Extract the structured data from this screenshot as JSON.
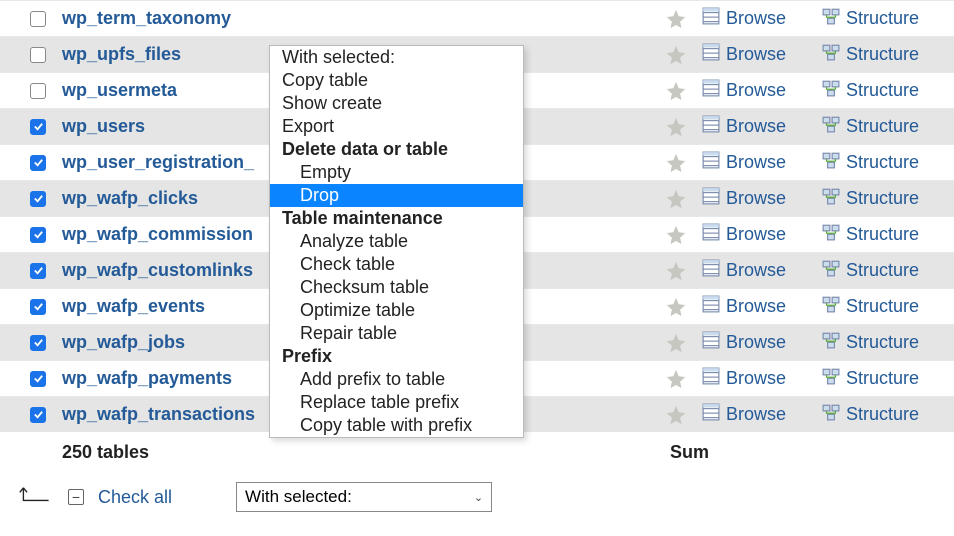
{
  "rows": [
    {
      "name": "wp_term_taxonomy",
      "checked": false,
      "alt": false
    },
    {
      "name": "wp_upfs_files",
      "checked": false,
      "alt": true
    },
    {
      "name": "wp_usermeta",
      "checked": false,
      "alt": false
    },
    {
      "name": "wp_users",
      "checked": true,
      "alt": true
    },
    {
      "name": "wp_user_registration_",
      "checked": true,
      "alt": false
    },
    {
      "name": "wp_wafp_clicks",
      "checked": true,
      "alt": true
    },
    {
      "name": "wp_wafp_commission",
      "checked": true,
      "alt": false
    },
    {
      "name": "wp_wafp_customlinks",
      "checked": true,
      "alt": true
    },
    {
      "name": "wp_wafp_events",
      "checked": true,
      "alt": false
    },
    {
      "name": "wp_wafp_jobs",
      "checked": true,
      "alt": true
    },
    {
      "name": "wp_wafp_payments",
      "checked": true,
      "alt": false
    },
    {
      "name": "wp_wafp_transactions",
      "checked": true,
      "alt": true
    }
  ],
  "actions": {
    "browse": "Browse",
    "structure": "Structure"
  },
  "summary": {
    "count": "250 tables",
    "sum": "Sum"
  },
  "bottom": {
    "check_all": "Check all",
    "dropdown": "With selected:"
  },
  "ctx": {
    "header1": "With selected:",
    "copy": "Copy table",
    "show_create": "Show create",
    "export": "Export",
    "header2": "Delete data or table",
    "empty": "Empty",
    "drop": "Drop",
    "header3": "Table maintenance",
    "analyze": "Analyze table",
    "check": "Check table",
    "checksum": "Checksum table",
    "optimize": "Optimize table",
    "repair": "Repair table",
    "header4": "Prefix",
    "add_prefix": "Add prefix to table",
    "replace_prefix": "Replace table prefix",
    "copy_prefix": "Copy table with prefix"
  }
}
